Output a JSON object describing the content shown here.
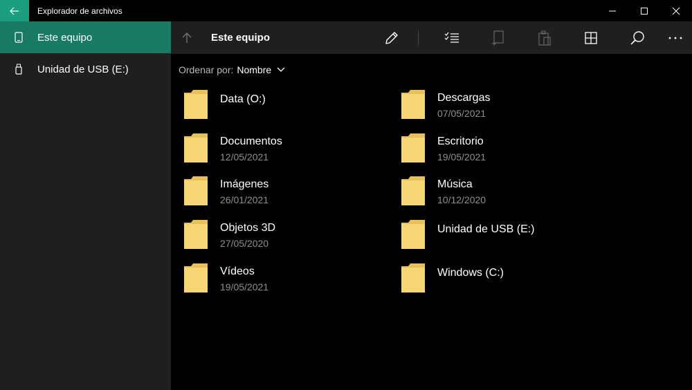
{
  "window": {
    "title": "Explorador de archivos"
  },
  "sidebar": {
    "items": [
      {
        "label": "Este equipo",
        "icon": "tablet-icon",
        "selected": true
      },
      {
        "label": "Unidad de USB (E:)",
        "icon": "usb-drive-icon",
        "selected": false
      }
    ]
  },
  "toolbar": {
    "location": "Este equipo",
    "buttons": [
      "rename-icon",
      "select-list-icon",
      "new-item-icon",
      "paste-icon",
      "view-grid-icon",
      "search-icon",
      "more-icon"
    ]
  },
  "sort": {
    "label": "Ordenar por:",
    "value": "Nombre"
  },
  "folders": [
    {
      "name": "Data (O:)",
      "date": ""
    },
    {
      "name": "Descargas",
      "date": "07/05/2021"
    },
    {
      "name": "Documentos",
      "date": "12/05/2021"
    },
    {
      "name": "Escritorio",
      "date": "19/05/2021"
    },
    {
      "name": "Imágenes",
      "date": "26/01/2021"
    },
    {
      "name": "Música",
      "date": "10/12/2020"
    },
    {
      "name": "Objetos 3D",
      "date": "27/05/2020"
    },
    {
      "name": "Unidad de USB (E:)",
      "date": ""
    },
    {
      "name": "Vídeos",
      "date": "19/05/2021"
    },
    {
      "name": "Windows (C:)",
      "date": ""
    }
  ],
  "colors": {
    "accent": "#1a9e7e",
    "accent_selected": "#187a63",
    "folder": "#f7d774"
  }
}
